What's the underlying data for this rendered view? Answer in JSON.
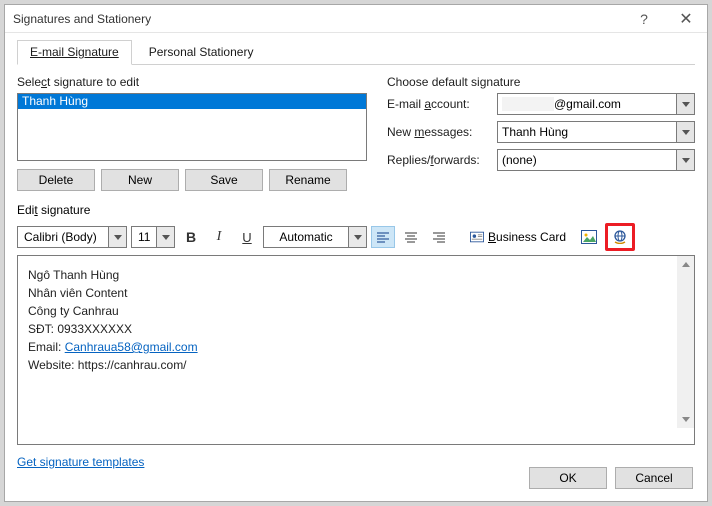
{
  "window": {
    "title": "Signatures and Stationery"
  },
  "tabs": {
    "email": "E-mail Signature",
    "personal": "Personal Stationery"
  },
  "left": {
    "title": "Select signature to edit",
    "item": "Thanh Hùng",
    "delete": "Delete",
    "new": "New",
    "save": "Save",
    "rename": "Rename"
  },
  "right": {
    "title": "Choose default signature",
    "email_label": "E-mail account:",
    "email_value": "@gmail.com",
    "new_label": "New messages:",
    "new_value": "Thanh Hùng",
    "reply_label": "Replies/forwards:",
    "reply_value": "(none)"
  },
  "editSection": {
    "title": "Edit signature"
  },
  "toolbar": {
    "font": "Calibri (Body)",
    "size": "11",
    "auto": "Automatic",
    "biz": "Business Card"
  },
  "signature": {
    "line1": "Ngô Thanh Hùng",
    "line2": "Nhân viên Content",
    "line3": "Công ty Canhrau",
    "line4": "SĐT: 0933XXXXXX",
    "line5a": "Email: ",
    "line5b": "Canhraua58@gmail.com",
    "line6": "Website: https://canhrau.com/"
  },
  "link": "Get signature templates",
  "footer": {
    "ok": "OK",
    "cancel": "Cancel"
  }
}
